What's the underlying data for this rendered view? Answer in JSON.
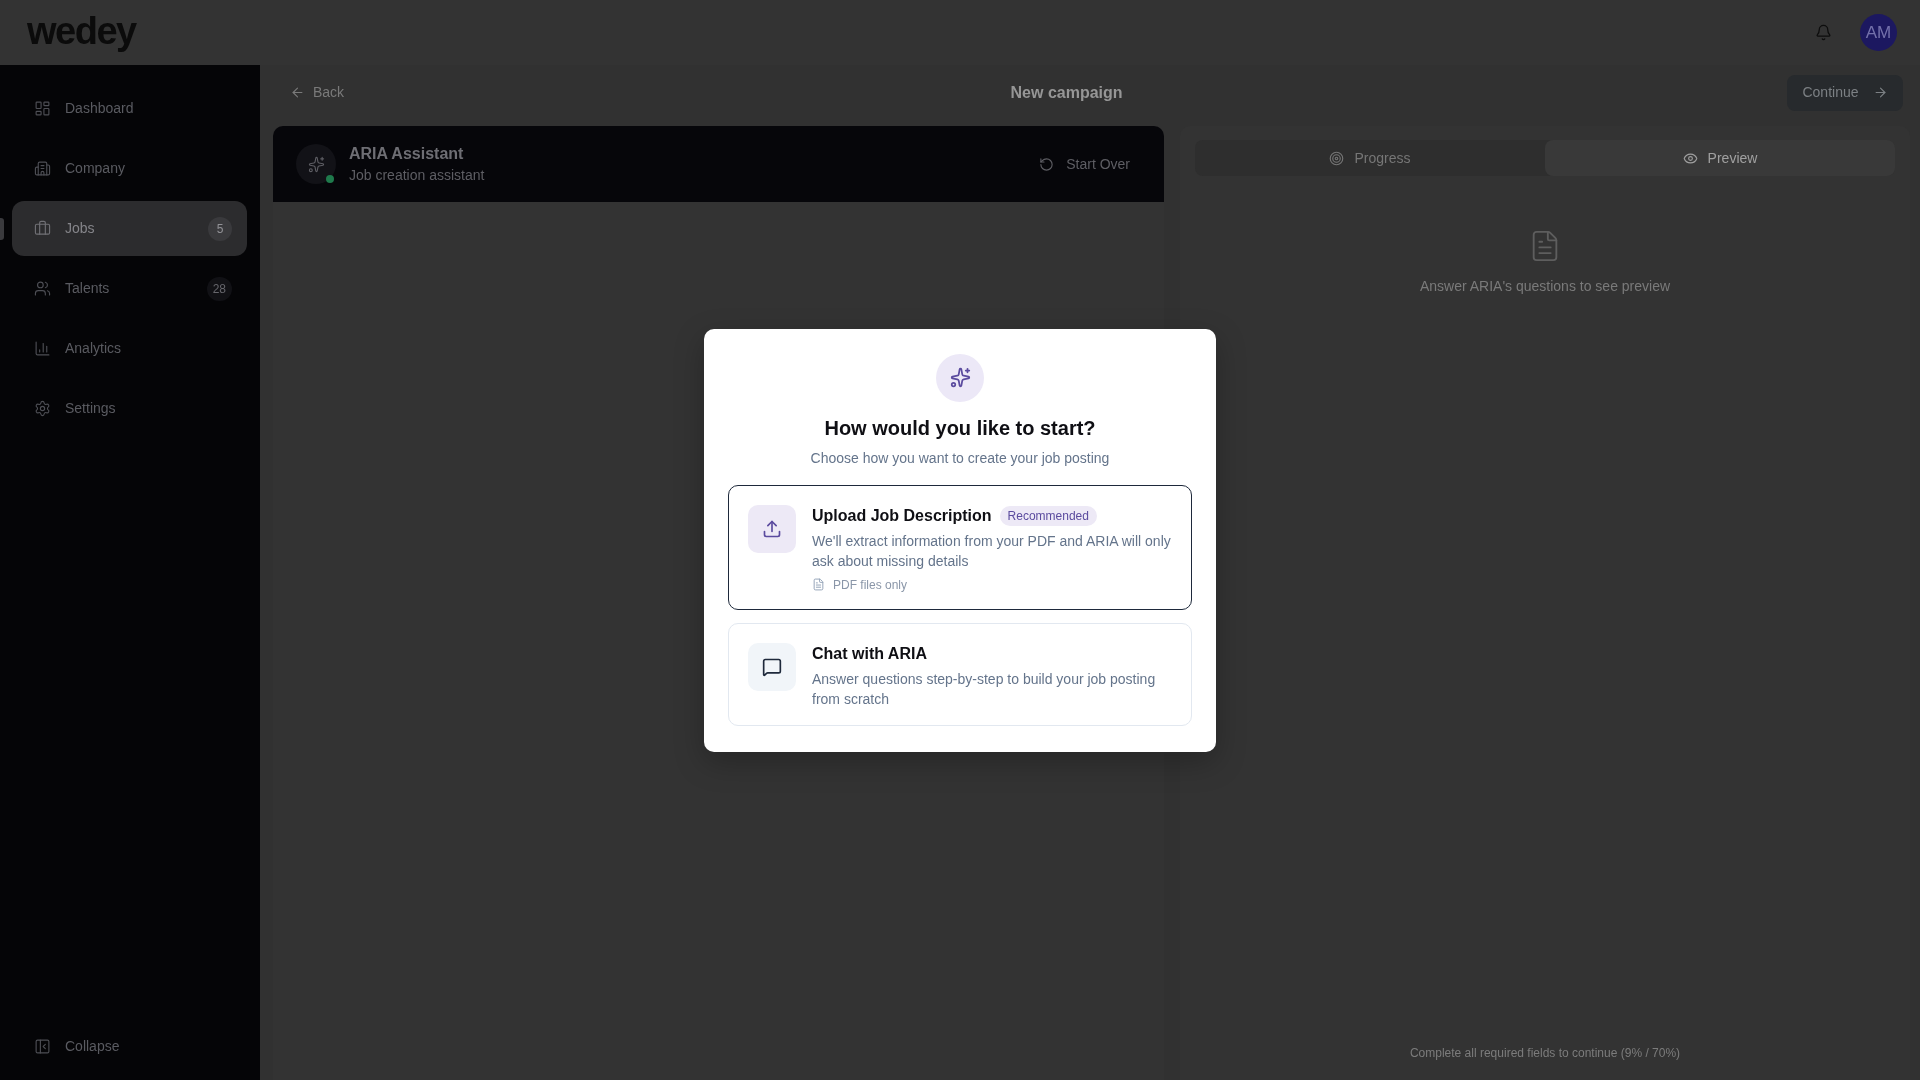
{
  "header": {
    "logo": "wedey",
    "avatar": {
      "initials": "AM"
    }
  },
  "sidebar": {
    "items": [
      {
        "label": "Dashboard",
        "selected": false
      },
      {
        "label": "Company",
        "selected": false
      },
      {
        "label": "Jobs",
        "badge": "5",
        "selected": true
      },
      {
        "label": "Talents",
        "badge": "28",
        "selected": false
      },
      {
        "label": "Analytics",
        "selected": false
      },
      {
        "label": "Settings",
        "selected": false
      }
    ],
    "collapse": "Collapse"
  },
  "topbar": {
    "back": "Back",
    "title": "New campaign",
    "continue": "Continue"
  },
  "assistant": {
    "name": "ARIA Assistant",
    "subtitle": "Job creation assistant",
    "online": true,
    "start_over": "Start Over"
  },
  "right_panel": {
    "tabs": [
      {
        "label": "Progress",
        "selected": false
      },
      {
        "label": "Preview",
        "selected": true
      }
    ],
    "empty_message": "Answer ARIA's questions to see preview",
    "footer": "Complete all required fields to continue (9% / 70%)"
  },
  "modal": {
    "title": "How would you like to start?",
    "subtitle": "Choose how you want to create your job posting",
    "options": [
      {
        "kind": "upload",
        "title": "Upload Job Description",
        "badge": "Recommended",
        "description": "We'll extract information from your PDF and ARIA will only ask about missing details",
        "note": "PDF files only",
        "selected": true
      },
      {
        "kind": "chat",
        "title": "Chat with ARIA",
        "description": "Answer questions step-by-step to build your job posting from scratch",
        "selected": false
      }
    ]
  }
}
